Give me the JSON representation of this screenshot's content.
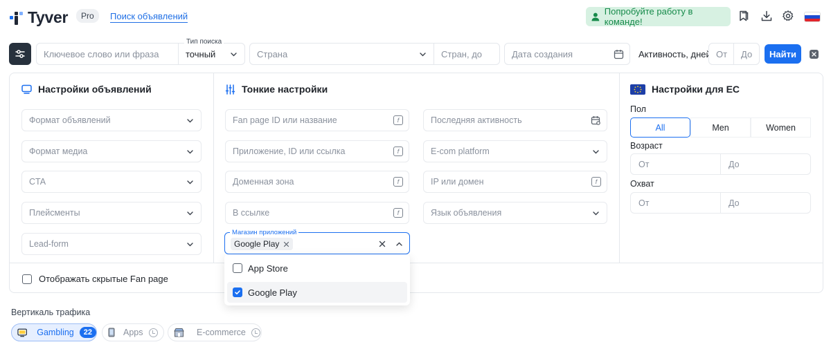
{
  "header": {
    "brand": "Tyver",
    "plan_badge": "Pro",
    "nav_link": "Поиск объявлений",
    "team_cta": "Попробуйте работу в команде!",
    "icons": [
      "user-icon",
      "bookmark-icon",
      "download-icon",
      "gear-icon",
      "flag-ru-icon"
    ]
  },
  "search": {
    "keyword_placeholder": "Ключевое слово или фраза",
    "search_type_label": "Тип поиска",
    "search_type_value": "точный",
    "country_placeholder": "Страна",
    "countries_to_placeholder": "Стран, до",
    "date_placeholder": "Дата создания",
    "activity_label": "Активность, дней",
    "from_placeholder": "От",
    "to_placeholder": "До",
    "find_label": "Найти"
  },
  "ad_settings": {
    "title": "Настройки объявлений",
    "fields": [
      "Формат объявлений",
      "Формат медиа",
      "CTA",
      "Плейсменты",
      "Lead-form"
    ]
  },
  "fine_settings": {
    "title": "Тонкие настройки",
    "left_fields": [
      "Fan page ID или название",
      "Приложение, ID или ссылка",
      "Доменная зона",
      "В ссылке"
    ],
    "right_fields": [
      "Последняя активность",
      "E-com platform",
      "IP или домен",
      "Язык объявления"
    ],
    "app_store_label": "Магазин приложений",
    "app_store_selected": "Google Play",
    "app_store_options": [
      {
        "label": "App Store",
        "checked": false
      },
      {
        "label": "Google Play",
        "checked": true
      }
    ]
  },
  "eu_settings": {
    "title": "Настройки для ЕС",
    "gender_label": "Пол",
    "gender_options": [
      "All",
      "Men",
      "Women"
    ],
    "gender_selected": "All",
    "age_label": "Возраст",
    "reach_label": "Охват",
    "from_placeholder": "От",
    "to_placeholder": "До"
  },
  "hidden_fanpage_label": "Отображать скрытые Fan page",
  "traffic": {
    "title": "Вертикаль трафика",
    "chips": [
      {
        "label": "Gambling",
        "count": "22",
        "active": true
      },
      {
        "label": "Apps",
        "active": false
      },
      {
        "label": "E-commerce",
        "active": false
      }
    ]
  },
  "colors": {
    "accent": "#1b6ff0",
    "team_bg": "#d7f1e2",
    "team_text": "#168a4a",
    "dark_button": "#27313d"
  }
}
